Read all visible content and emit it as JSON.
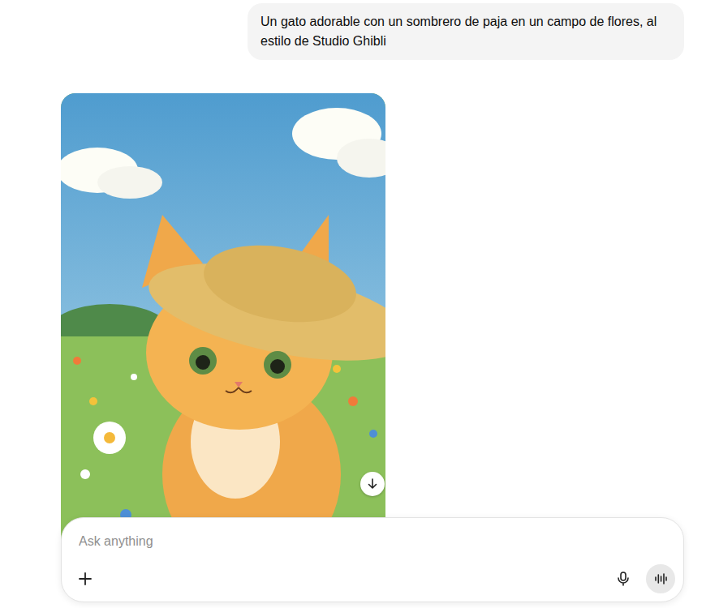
{
  "conversation": {
    "messages": [
      {
        "kind": "text",
        "text": "Un gato adorable con un sombrero de paja en un campo de flores, al estilo de Studio Ghibli"
      },
      {
        "kind": "image"
      }
    ]
  },
  "composer": {
    "placeholder": "Ask anything"
  }
}
